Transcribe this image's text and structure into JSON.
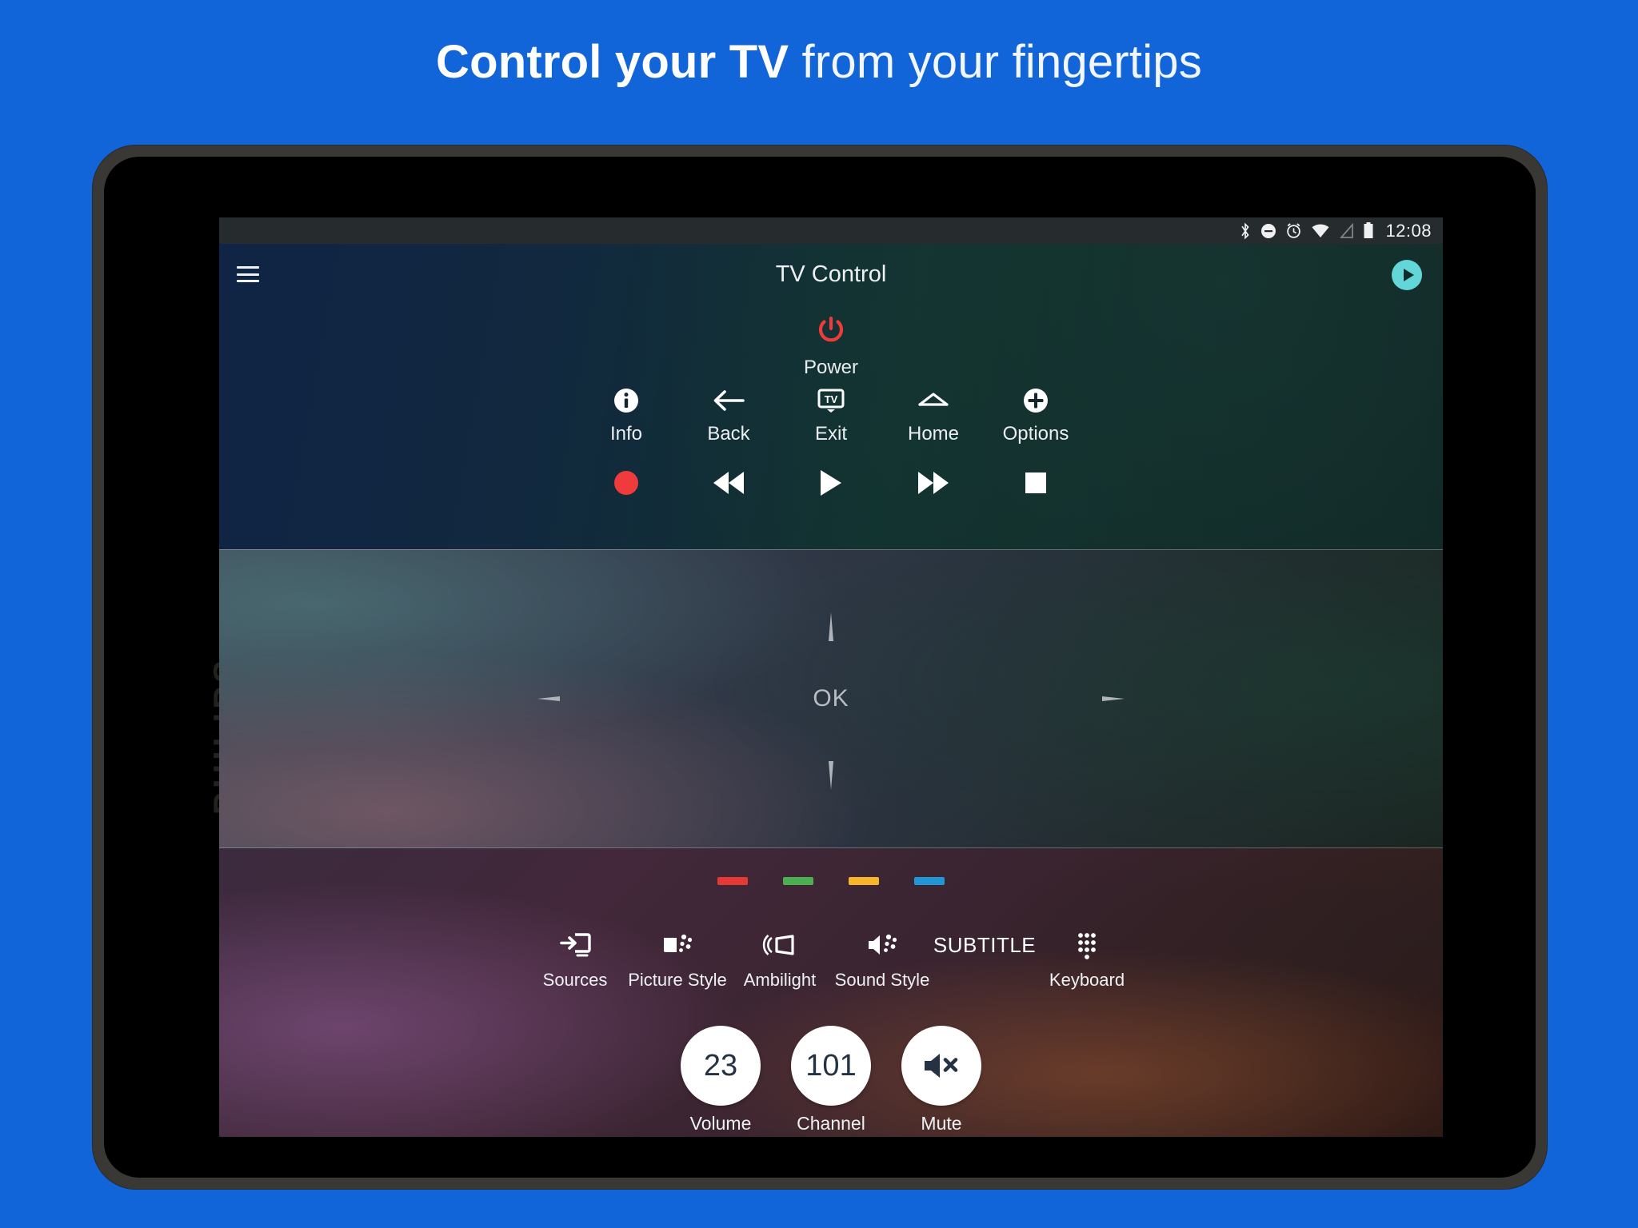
{
  "headline": {
    "strong": "Control your TV",
    "light": " from your fingertips"
  },
  "device": {
    "brand": "PHILIPS"
  },
  "statusbar": {
    "icons": [
      "bluetooth-icon",
      "do-not-disturb-icon",
      "alarm-icon",
      "wifi-icon",
      "cell-signal-icon",
      "battery-icon"
    ],
    "time": "12:08"
  },
  "appbar": {
    "menu_icon": "hamburger-menu-icon",
    "title": "TV Control",
    "play_icon": "play-circle-icon"
  },
  "power": {
    "label": "Power",
    "color": "#ef3b3b"
  },
  "nav_buttons": [
    {
      "label": "Info",
      "icon": "info-icon"
    },
    {
      "label": "Back",
      "icon": "arrow-left-icon"
    },
    {
      "label": "Exit",
      "icon": "tv-icon"
    },
    {
      "label": "Home",
      "icon": "home-icon"
    },
    {
      "label": "Options",
      "icon": "plus-circle-icon"
    }
  ],
  "transport_buttons": [
    {
      "name": "record",
      "icon": "record-dot-icon"
    },
    {
      "name": "rewind",
      "icon": "rewind-icon"
    },
    {
      "name": "play",
      "icon": "play-icon"
    },
    {
      "name": "fast-forward",
      "icon": "fast-forward-icon"
    },
    {
      "name": "stop",
      "icon": "stop-icon"
    }
  ],
  "touchpad": {
    "ok_label": "OK",
    "up": "dpad-up",
    "down": "dpad-down",
    "left": "dpad-left",
    "right": "dpad-right"
  },
  "color_buttons": [
    {
      "name": "red",
      "color": "#e53935"
    },
    {
      "name": "green",
      "color": "#4caf50"
    },
    {
      "name": "yellow",
      "color": "#f7b52b"
    },
    {
      "name": "blue",
      "color": "#2196d4"
    }
  ],
  "function_buttons": [
    {
      "label": "Sources",
      "icon": "sources-icon"
    },
    {
      "label": "Picture Style",
      "icon": "picture-style-icon"
    },
    {
      "label": "Ambilight",
      "icon": "ambilight-icon"
    },
    {
      "label": "Sound Style",
      "icon": "sound-style-icon"
    },
    {
      "label": "",
      "icon": "subtitle-text",
      "text": "SUBTITLE"
    },
    {
      "label": "Keyboard",
      "icon": "dialpad-icon"
    }
  ],
  "big_buttons": [
    {
      "value": "23",
      "label": "Volume",
      "icon": ""
    },
    {
      "value": "101",
      "label": "Channel",
      "icon": ""
    },
    {
      "value": "",
      "label": "Mute",
      "icon": "mute-icon"
    }
  ]
}
